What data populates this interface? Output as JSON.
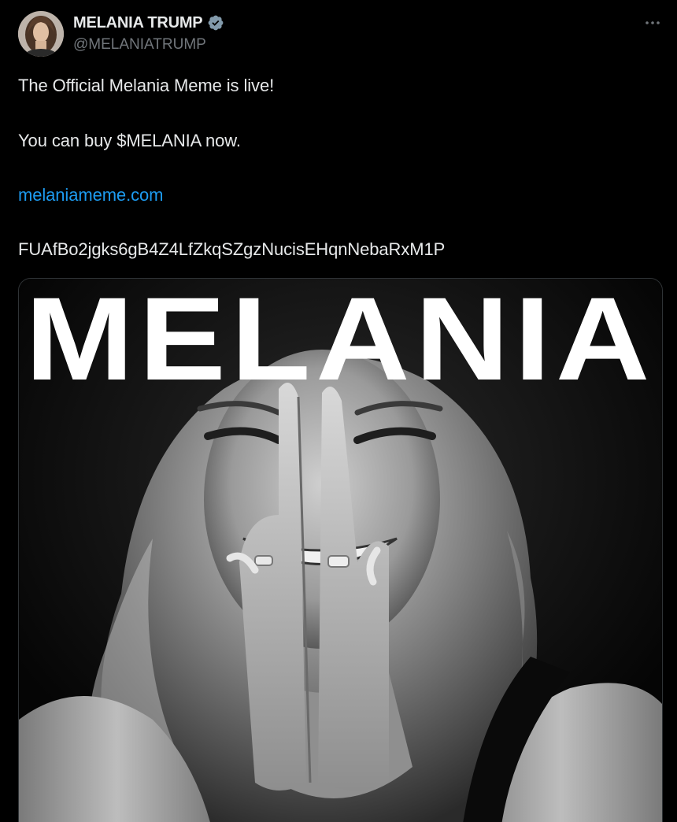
{
  "author": {
    "display_name": "MELANIA TRUMP",
    "handle": "@MELANIATRUMP",
    "verified": true
  },
  "tweet": {
    "lines": [
      "The Official Melania Meme is live!",
      "You can buy $MELANIA now.",
      "melaniameme.com",
      "FUAfBo2jgks6gB4Z4LfZkqSZgzNucisEHqnNebaRxM1P"
    ]
  },
  "media": {
    "headline": "MELANIA",
    "style": "black-and-white portrait"
  },
  "icons": {
    "verified": "verified-badge-icon",
    "more": "more-options-icon"
  },
  "colors": {
    "background": "#000000",
    "text": "#e7e9ea",
    "secondary": "#71767b",
    "link": "#1d9bf0",
    "verified": "#829aab"
  }
}
